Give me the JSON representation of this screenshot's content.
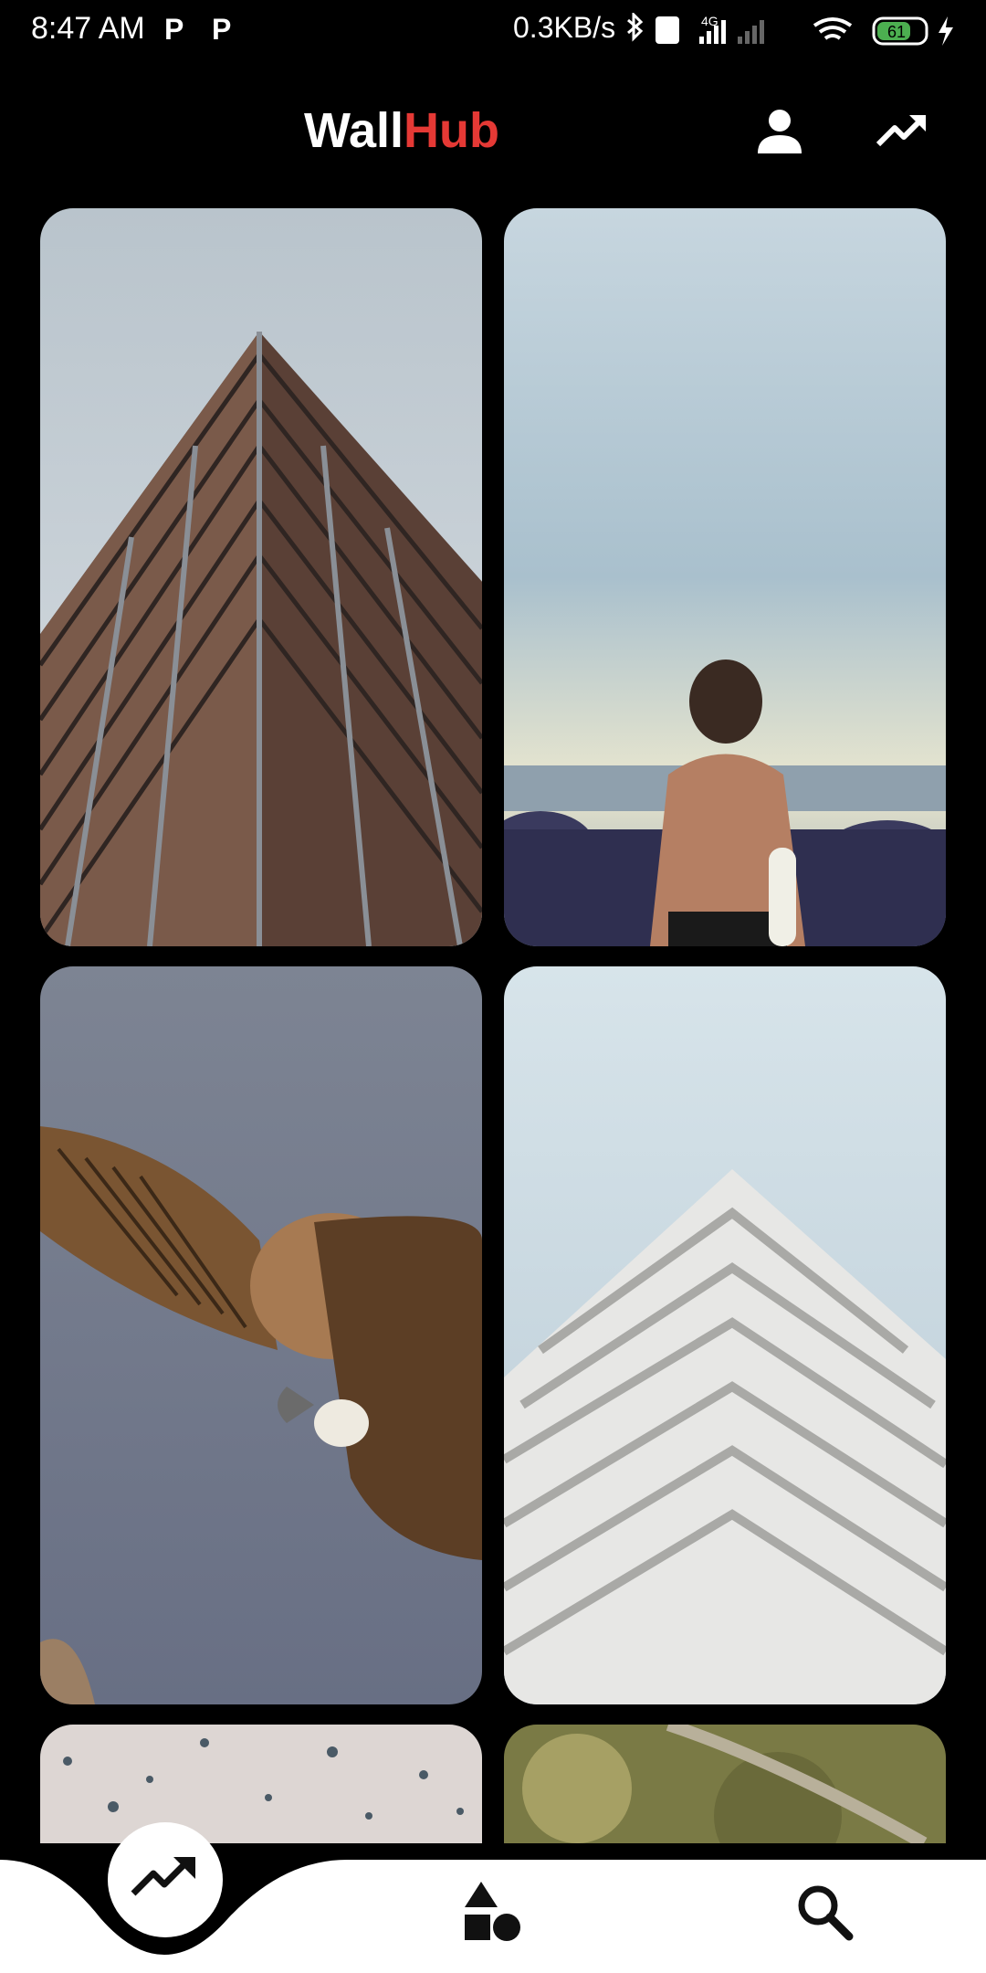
{
  "status_bar": {
    "time": "8:47 AM",
    "notif_1": "P",
    "notif_2": "P",
    "net_speed": "0.3KB/s",
    "battery": "61",
    "net_type": "4G"
  },
  "app_bar": {
    "title_part1": "Wall",
    "title_part2": "Hub",
    "icons": [
      "person-icon",
      "trending-icon"
    ]
  },
  "wallpapers": [
    {
      "name": "Building looking up (brown)"
    },
    {
      "name": "Man at beach"
    },
    {
      "name": "Vulture"
    },
    {
      "name": "White pyramid building"
    },
    {
      "name": "Snow texture"
    },
    {
      "name": "Tree branch"
    }
  ],
  "bottom_nav": {
    "items": [
      "trending-icon",
      "categories-icon",
      "search-icon"
    ],
    "active": "trending-icon"
  },
  "colors": {
    "accent": "#e53935",
    "background": "#000000",
    "nav_bg": "#ffffff"
  }
}
